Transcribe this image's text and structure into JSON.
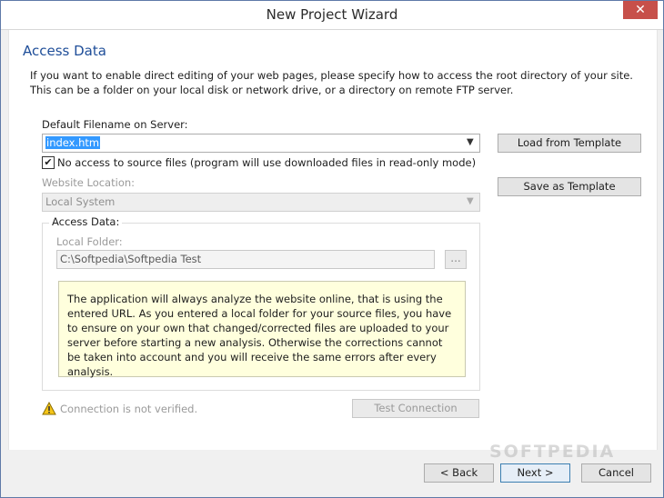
{
  "window": {
    "title": "New Project Wizard",
    "close_glyph": "✕"
  },
  "page": {
    "heading": "Access Data",
    "intro": "If you want to enable direct editing of your web pages, please specify how to access the root directory of your site. This can be a folder on your local disk or network drive, or a directory on remote FTP server."
  },
  "filename": {
    "label": "Default Filename on Server:",
    "value": "index.htm"
  },
  "no_access": {
    "checked": true,
    "label": "No access to source files (program will use downloaded files in read-only mode)"
  },
  "website_location": {
    "label": "Website Location:",
    "value": "Local System"
  },
  "access_data": {
    "group_label": "Access Data:",
    "local_folder_label": "Local Folder:",
    "local_folder_value": "C:\\Softpedia\\Softpedia Test",
    "browse_label": "...",
    "info": "The application will always analyze the website online, that is using the entered URL. As you entered a local folder for your source files, you have to ensure on your own that changed/corrected files are uploaded to your server before starting a new analysis. Otherwise the corrections cannot be taken into account and you will receive the same errors after every analysis."
  },
  "connection": {
    "status": "Connection is not verified.",
    "test_button": "Test Connection"
  },
  "templates": {
    "load": "Load from Template",
    "save": "Save as Template"
  },
  "footer": {
    "back": "< Back",
    "next": "Next >",
    "cancel": "Cancel"
  },
  "watermark": "SOFTPEDIA",
  "icons": [
    "close-icon",
    "dropdown-arrow-icon",
    "checkmark-icon",
    "warning-icon"
  ],
  "colors": {
    "heading": "#1f4e99",
    "info_bg": "#ffffdd",
    "close_bg": "#c7504a",
    "selection": "#3399ff"
  }
}
